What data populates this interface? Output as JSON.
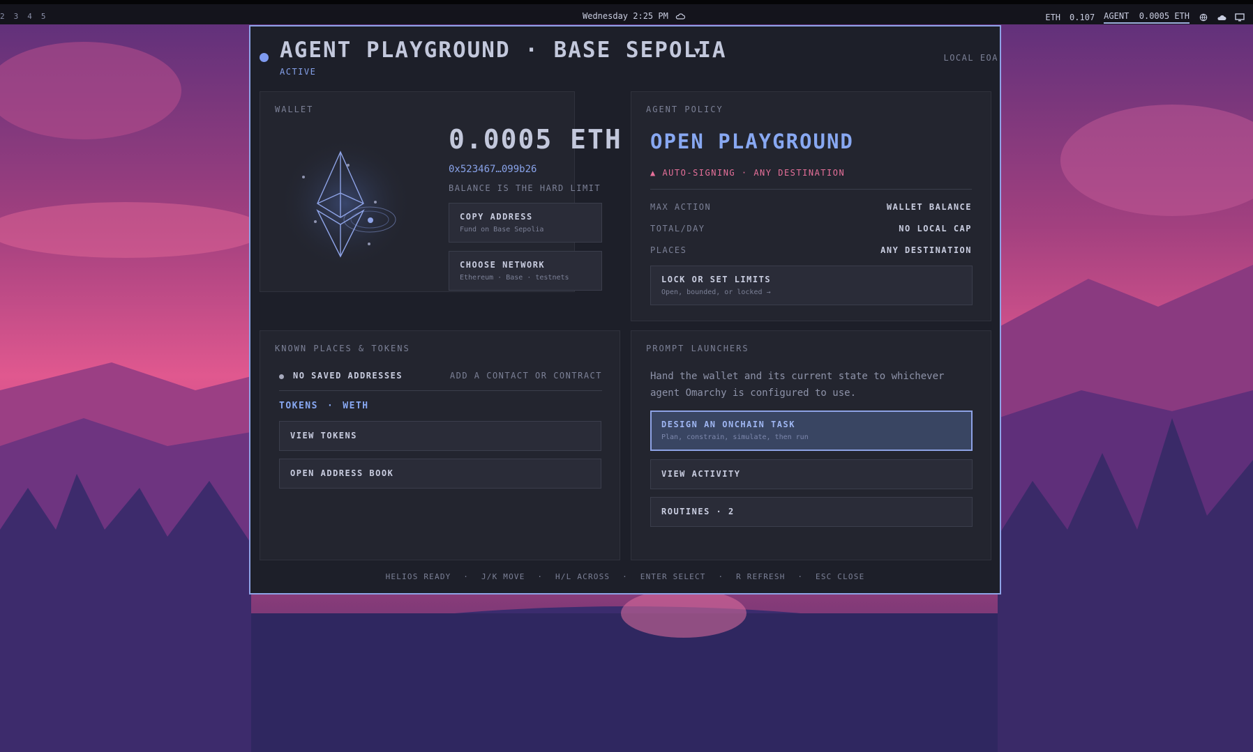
{
  "topbar": {
    "workspaces": [
      "2",
      "3",
      "4",
      "5"
    ],
    "clock": "Wednesday 2:25 PM",
    "eth_label": "ETH",
    "eth_price": "0.107",
    "agent_label": "AGENT",
    "agent_balance": "0.0005 ETH",
    "icons": [
      "weather-icon",
      "globe-icon",
      "cloud-icon",
      "monitor-icon"
    ]
  },
  "window": {
    "title": "AGENT PLAYGROUND · BASE SEPOLIA",
    "caret": "▼",
    "status": "ACTIVE",
    "mode": "LOCAL EOA"
  },
  "wallet": {
    "heading": "WALLET",
    "balance": "0.0005 ETH",
    "address": "0x523467…099b26",
    "hint": "BALANCE IS THE HARD LIMIT",
    "copy_label": "COPY ADDRESS",
    "copy_sub": "Fund on Base Sepolia",
    "network_label": "CHOOSE NETWORK",
    "network_sub": "Ethereum · Base · testnets"
  },
  "policy": {
    "heading": "AGENT POLICY",
    "mode": "OPEN PLAYGROUND",
    "warning": "▲ AUTO-SIGNING · ANY DESTINATION",
    "rows": [
      {
        "key": "MAX ACTION",
        "value": "WALLET BALANCE"
      },
      {
        "key": "TOTAL/DAY",
        "value": "NO LOCAL CAP"
      },
      {
        "key": "PLACES",
        "value": "ANY DESTINATION"
      }
    ],
    "lock_label": "LOCK OR SET LIMITS",
    "lock_sub": "Open, bounded, or locked  →"
  },
  "places": {
    "heading": "KNOWN PLACES & TOKENS",
    "empty_label": "NO SAVED ADDRESSES",
    "add_link": "ADD A CONTACT OR CONTRACT",
    "tokens_label": "TOKENS",
    "tokens_sep": "·",
    "token_name": "WETH",
    "view_tokens": "VIEW TOKENS",
    "address_book": "OPEN ADDRESS BOOK"
  },
  "launchers": {
    "heading": "PROMPT LAUNCHERS",
    "description": "Hand the wallet and its current state to whichever agent Omarchy is configured to use.",
    "design_label": "DESIGN AN ONCHAIN TASK",
    "design_sub": "Plan, constrain, simulate, then run",
    "activity": "VIEW ACTIVITY",
    "routines": "ROUTINES  ·  2"
  },
  "footer": [
    "HELIOS READY",
    "·",
    "J/K MOVE",
    "·",
    "H/L ACROSS",
    "·",
    "ENTER SELECT",
    "·",
    "R REFRESH",
    "·",
    "ESC CLOSE"
  ],
  "colors": {
    "accent": "#8ea3e6",
    "warning": "#e7709a",
    "window_bg": "#1d1f29",
    "panel_bg": "#23252f"
  }
}
